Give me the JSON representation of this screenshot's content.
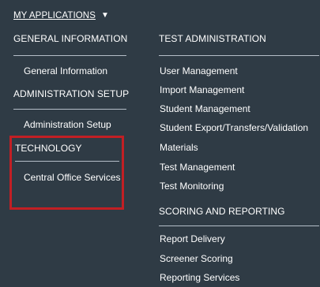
{
  "menu": {
    "trigger_label": "MY APPLICATIONS",
    "caret_icon": "caret-down-icon",
    "left_column": {
      "sections": [
        {
          "heading": "GENERAL INFORMATION",
          "items": [
            "General Information"
          ]
        },
        {
          "heading": "ADMINISTRATION SETUP",
          "items": [
            "Administration Setup"
          ]
        },
        {
          "heading": "TECHNOLOGY",
          "items": [
            "Central Office Services"
          ]
        }
      ]
    },
    "right_column": {
      "sections": [
        {
          "heading": "TEST ADMINISTRATION",
          "items": [
            "User Management",
            "Import Management",
            "Student Management",
            "Student Export/Transfers/Validation",
            "Materials",
            "Test Management",
            "Test Monitoring"
          ]
        },
        {
          "heading": "SCORING AND REPORTING",
          "items": [
            "Report Delivery",
            "Screener Scoring",
            "Reporting Services"
          ]
        }
      ]
    },
    "highlight_color": "#c21f24",
    "background_color": "#2f3b45"
  }
}
